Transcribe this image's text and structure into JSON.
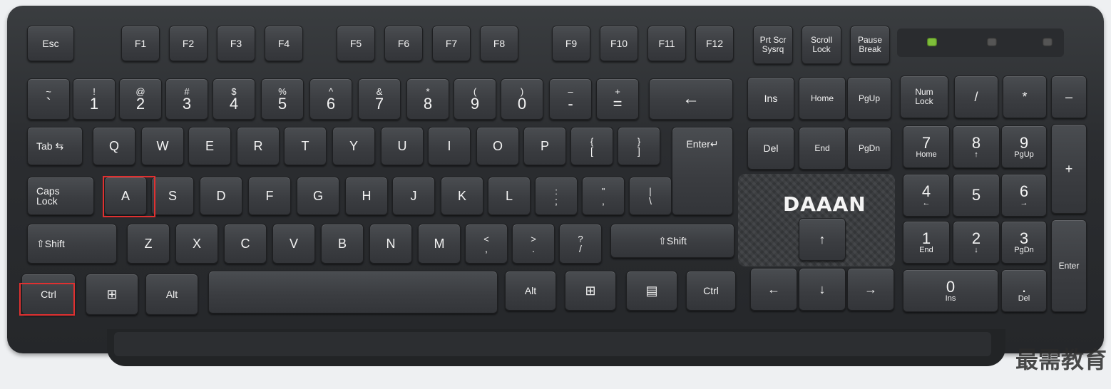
{
  "brand": "DAAAN",
  "watermark": "最需教育",
  "row_function": {
    "esc": "Esc",
    "f1": "F1",
    "f2": "F2",
    "f3": "F3",
    "f4": "F4",
    "f5": "F5",
    "f6": "F6",
    "f7": "F7",
    "f8": "F8",
    "f9": "F9",
    "f10": "F10",
    "f11": "F11",
    "f12": "F12",
    "prtscr": "Prt Scr",
    "sysrq": "Sysrq",
    "scroll": "Scroll",
    "lock": "Lock",
    "pause": "Pause",
    "break": "Break"
  },
  "row_number": [
    {
      "top": "~",
      "bot": "`"
    },
    {
      "top": "!",
      "bot": "1"
    },
    {
      "top": "@",
      "bot": "2"
    },
    {
      "top": "#",
      "bot": "3"
    },
    {
      "top": "$",
      "bot": "4"
    },
    {
      "top": "%",
      "bot": "5"
    },
    {
      "top": "^",
      "bot": "6"
    },
    {
      "top": "&",
      "bot": "7"
    },
    {
      "top": "*",
      "bot": "8"
    },
    {
      "top": "(",
      "bot": "9"
    },
    {
      "top": ")",
      "bot": "0"
    },
    {
      "top": "–",
      "bot": "-"
    },
    {
      "top": "+",
      "bot": "="
    }
  ],
  "backspace": "←",
  "row_q": {
    "tab": "Tab",
    "tab_icon": "⇆",
    "letters": [
      "Q",
      "W",
      "E",
      "R",
      "T",
      "Y",
      "U",
      "I",
      "O",
      "P"
    ],
    "lbrace_top": "{",
    "lbrace_bot": "[",
    "rbrace_top": "}",
    "rbrace_bot": "]",
    "enter": "Enter↵"
  },
  "row_a": {
    "caps1": "Caps",
    "caps2": "Lock",
    "letters": [
      "A",
      "S",
      "D",
      "F",
      "G",
      "H",
      "J",
      "K",
      "L"
    ],
    "semi_top": ":",
    "semi_bot": ";",
    "quote_top": "\"",
    "quote_bot": ",",
    "pipe_top": "|",
    "pipe_bot": "\\"
  },
  "row_z": {
    "lshift": "⇧Shift",
    "letters": [
      "Z",
      "X",
      "C",
      "V",
      "B",
      "N",
      "M"
    ],
    "lt_top": "<",
    "lt_bot": ",",
    "gt_top": ">",
    "gt_bot": ".",
    "q_top": "?",
    "q_bot": "/",
    "rshift": "⇧Shift"
  },
  "row_bottom": {
    "lctrl": "Ctrl",
    "lwin": "⊞",
    "lalt": "Alt",
    "ralt": "Alt",
    "rwin": "⊞",
    "menu": "▤",
    "rctrl": "Ctrl"
  },
  "nav": {
    "ins": "Ins",
    "home": "Home",
    "pgup": "PgUp",
    "del": "Del",
    "end": "End",
    "pgdn": "PgDn",
    "up": "↑",
    "left": "←",
    "down": "↓",
    "right": "→"
  },
  "numpad": {
    "numlock1": "Num",
    "numlock2": "Lock",
    "div": "/",
    "mul": "*",
    "minus": "–",
    "plus": "+",
    "enter": "Enter",
    "n7": "7",
    "n7s": "Home",
    "n8": "8",
    "n8s": "↑",
    "n9": "9",
    "n9s": "PgUp",
    "n4": "4",
    "n4s": "←",
    "n5": "5",
    "n5s": "",
    "n6": "6",
    "n6s": "→",
    "n1": "1",
    "n1s": "End",
    "n2": "2",
    "n2s": "↓",
    "n3": "3",
    "n3s": "PgDn",
    "n0": "0",
    "n0s": "Ins",
    "dot": ".",
    "dots": "Del"
  }
}
